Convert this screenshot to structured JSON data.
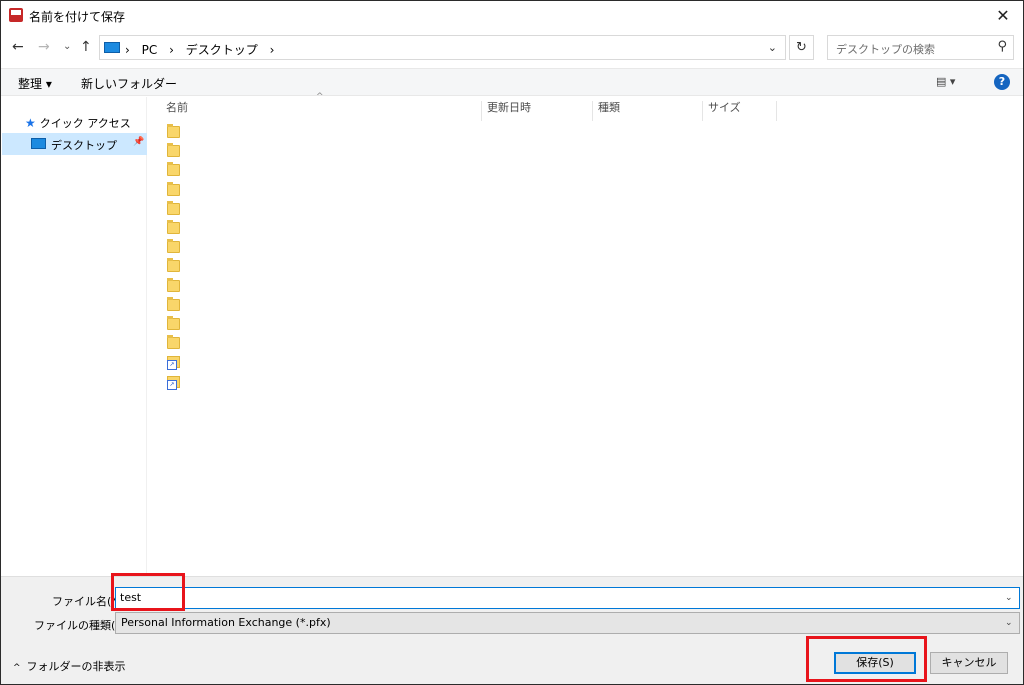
{
  "window": {
    "title": "名前を付けて保存",
    "close_glyph": "✕"
  },
  "nav": {
    "back": "←",
    "forward": "→",
    "recent": "⌄",
    "up": "↑"
  },
  "address": {
    "segments": [
      "›",
      "PC",
      "›",
      "デスクトップ",
      "›"
    ],
    "dropdown": "⌄",
    "refresh": "↻"
  },
  "search": {
    "placeholder": "デスクトップの検索",
    "icon": "⚲"
  },
  "toolbar": {
    "organize": "整理 ▾",
    "new_folder": "新しいフォルダー",
    "view": "▤ ▾",
    "help": "?"
  },
  "sidebar": {
    "quick_access": "クイック アクセス",
    "desktop": "デスクトップ",
    "pin": "📌"
  },
  "file_list": {
    "sort_indicator": "^",
    "columns": [
      "名前",
      "更新日時",
      "種類",
      "サイズ"
    ],
    "items": [
      {
        "kind": "folder"
      },
      {
        "kind": "folder"
      },
      {
        "kind": "folder"
      },
      {
        "kind": "folder"
      },
      {
        "kind": "folder"
      },
      {
        "kind": "folder"
      },
      {
        "kind": "folder"
      },
      {
        "kind": "folder"
      },
      {
        "kind": "folder"
      },
      {
        "kind": "folder"
      },
      {
        "kind": "folder"
      },
      {
        "kind": "folder"
      },
      {
        "kind": "shortcut"
      },
      {
        "kind": "shortcut"
      }
    ]
  },
  "form": {
    "filename_label": "ファイル名(N):",
    "filename_value": "test",
    "filetype_label": "ファイルの種類(T):",
    "filetype_value": "Personal Information Exchange (*.pfx)",
    "dropdown_glyph": "⌄",
    "hide_folders": "フォルダーの非表示",
    "hide_caret": "^",
    "save_label": "保存(S)",
    "cancel_label": "キャンセル"
  },
  "colors": {
    "highlight": "#e8141b",
    "accent": "#0078d7",
    "selection": "#cce8ff"
  }
}
